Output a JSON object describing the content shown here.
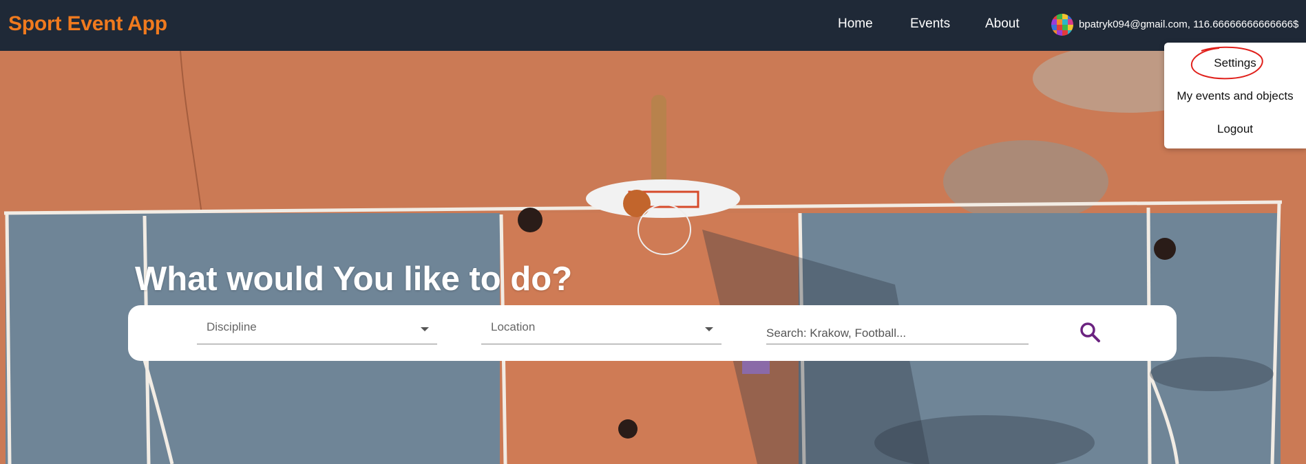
{
  "header": {
    "brand": "Sport Event App",
    "nav": [
      "Home",
      "Events",
      "About"
    ],
    "account": "bpatryk094@gmail.com, 116.66666666666666$"
  },
  "user_menu": {
    "items": [
      "Settings",
      "My events and objects",
      "Logout"
    ]
  },
  "hero": {
    "title": "What would You like to do?"
  },
  "search": {
    "discipline_label": "Discipline",
    "location_label": "Location",
    "query_placeholder": "Search: Krakow, Football..."
  },
  "colors": {
    "brand": "#f07a1e",
    "navbar": "#1f2937",
    "annotation": "#e0201b",
    "search_icon": "#6b2380"
  }
}
